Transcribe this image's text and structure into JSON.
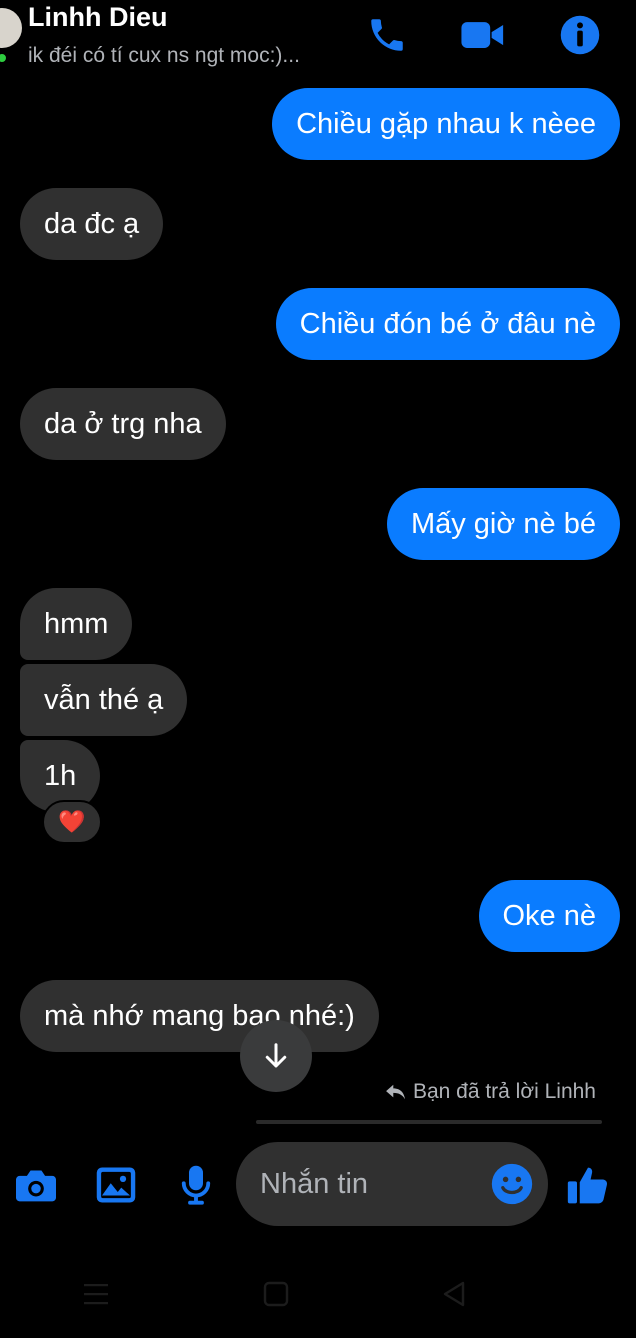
{
  "header": {
    "contact_name": "Linhh Dieu",
    "status": "ik đéi có tí cux ns ngt moc:)..."
  },
  "messages": [
    {
      "side": "out",
      "text": "Chiều gặp nhau k nèee"
    },
    {
      "side": "in",
      "text": "da đc ạ"
    },
    {
      "side": "out",
      "text": "Chiều đón bé ở đâu nè"
    },
    {
      "side": "in",
      "text": "da ở trg nha"
    },
    {
      "side": "out",
      "text": "Mấy giờ nè bé"
    },
    {
      "side": "in",
      "text": "hmm"
    },
    {
      "side": "in",
      "text": "vẫn thé ạ"
    },
    {
      "side": "in",
      "text": "1h",
      "reaction": "❤️"
    },
    {
      "side": "out",
      "text": "Oke nè"
    },
    {
      "side": "in",
      "text": "mà nhớ mang bao nhé:)"
    }
  ],
  "reply_note": "Bạn đã trả lời Linhh",
  "composer": {
    "placeholder": "Nhắn tin"
  },
  "colors": {
    "accent": "#0a7cff",
    "icon_blue": "#1877f2",
    "incoming_bubble": "#303030",
    "background": "#000000"
  },
  "icons": [
    "phone-icon",
    "video-camera-icon",
    "info-icon",
    "camera-icon",
    "image-icon",
    "microphone-icon",
    "emoji-icon",
    "thumbs-up-icon",
    "arrow-down-icon",
    "reply-icon",
    "nav-menu-icon",
    "nav-home-icon",
    "nav-back-icon"
  ]
}
